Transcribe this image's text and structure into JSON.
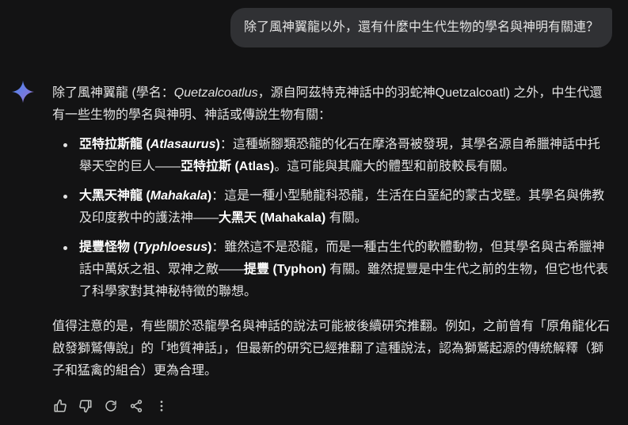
{
  "user_message": "除了風神翼龍以外，還有什麼中生代生物的學名與神明有關連？",
  "response": {
    "intro": {
      "a": "除了風神翼龍 (學名：",
      "b": "Quetzalcoatlus",
      "c": "，源自阿茲特克神話中的羽蛇神Quetzalcoatl) 之外，中生代還有一些生物的學名與神明、神話或傳說生物有關："
    },
    "items": [
      {
        "name": "亞特拉斯龍 (",
        "sci": "Atlasaurus",
        "name_end": ")",
        "t1": "：這種蜥腳類恐龍的化石在摩洛哥被發現，其學名源自希臘神話中托舉天空的巨人——",
        "deity": "亞特拉斯 (Atlas)",
        "t2": "。這可能與其龐大的體型和前肢較長有關。"
      },
      {
        "name": "大黑天神龍 (",
        "sci": "Mahakala",
        "name_end": ")",
        "t1": "：這是一種小型馳龍科恐龍，生活在白堊紀的蒙古戈壁。其學名與佛教及印度教中的護法神——",
        "deity": "大黑天 (Mahakala)",
        "t2": " 有關。"
      },
      {
        "name": "提豐怪物 (",
        "sci": "Typhloesus",
        "name_end": ")",
        "t1": "：雖然這不是恐龍，而是一種古生代的軟體動物，但其學名與古希臘神話中萬妖之祖、眾神之敵——",
        "deity": "提豐 (Typhon)",
        "t2": " 有關。雖然提豐是中生代之前的生物，但它也代表了科學家對其神秘特徵的聯想。"
      }
    ],
    "note": "值得注意的是，有些關於恐龍學名與神話的說法可能被後續研究推翻。例如，之前曾有「原角龍化石啟發獅鷲傳說」的「地質神話」，但最新的研究已經推翻了這種說法，認為獅鷲起源的傳統解釋（獅子和猛禽的組合）更為合理。"
  },
  "actions": [
    "thumbs-up-icon",
    "thumbs-down-icon",
    "regenerate-icon",
    "share-icon",
    "more-options-icon"
  ],
  "colors": {
    "background": "#131314",
    "bubble": "#303134",
    "text": "#e3e3e3",
    "sparkle_from": "#4285f4",
    "sparkle_to": "#9b72cb"
  }
}
